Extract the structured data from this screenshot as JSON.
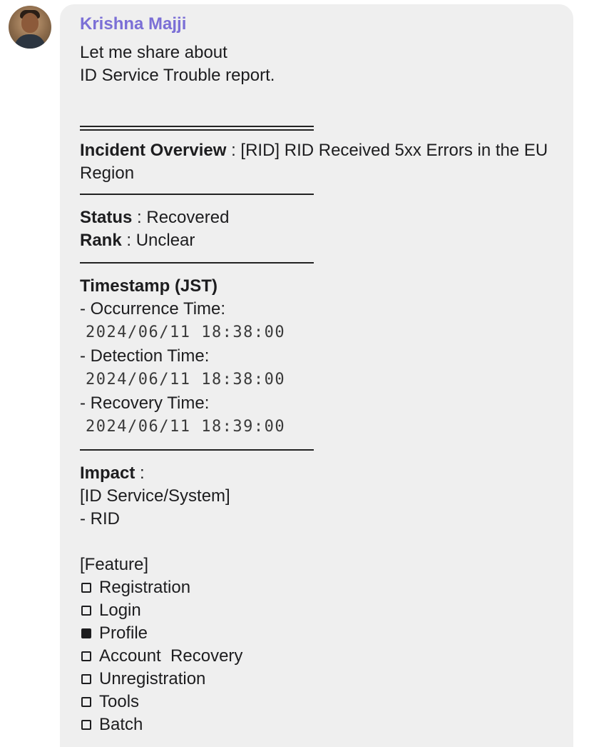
{
  "message": {
    "sender": "Krishna Majji",
    "intro_line1": "Let me share about",
    "intro_line2": "ID Service Trouble report.",
    "overview_label": "Incident Overview",
    "overview_value": " : [RID] RID Received 5xx Errors in the EU Region",
    "status_label": "Status",
    "status_value": " : Recovered",
    "rank_label": "Rank",
    "rank_value": " : Unclear",
    "timestamp_heading": "Timestamp (JST)",
    "occurrence_label": "- Occurrence Time:",
    "occurrence_value": "2024/06/11 18:38:00",
    "detection_label": "- Detection Time:",
    "detection_value": "2024/06/11 18:38:00",
    "recovery_label": "- Recovery Time:",
    "recovery_value": "2024/06/11 18:39:00",
    "impact_label": "Impact",
    "impact_suffix": " :",
    "system_heading": "[ID Service/System]",
    "system_item": "- RID",
    "feature_heading": "[Feature]",
    "features": [
      {
        "label": "Registration",
        "checked": false
      },
      {
        "label": "Login",
        "checked": false
      },
      {
        "label": "Profile",
        "checked": true
      },
      {
        "label": "Account  Recovery",
        "checked": false
      },
      {
        "label": "Unregistration",
        "checked": false
      },
      {
        "label": "Tools",
        "checked": false
      },
      {
        "label": "Batch",
        "checked": false
      }
    ]
  },
  "icons": {
    "avatar": "user-avatar-photo",
    "checkbox_empty": "empty-checkbox-icon",
    "checkbox_filled": "filled-checkbox-icon"
  }
}
